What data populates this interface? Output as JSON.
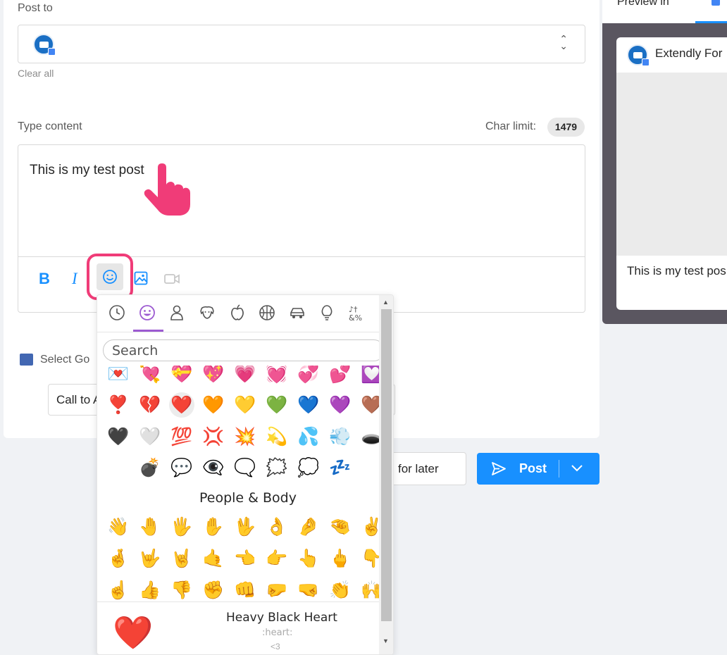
{
  "form": {
    "post_to_label": "Post to",
    "clear_all": "Clear all",
    "type_content_label": "Type content",
    "char_limit_label": "Char limit:",
    "char_limit_value": "1479",
    "content_text": "This is my test post",
    "gmb_label": "Select Go",
    "cta_value": "Call to A",
    "save_later": "for later",
    "post_button": "Post"
  },
  "preview": {
    "title": "Preview in",
    "account_name": "Extendly For",
    "post_text": "This is my test pos"
  },
  "emoji_picker": {
    "categories": [
      "recent-icon",
      "smileys-icon",
      "people-icon",
      "animals-icon",
      "food-icon",
      "activity-icon",
      "travel-icon",
      "objects-icon",
      "symbols-icon"
    ],
    "search_placeholder": "Search",
    "rows": [
      [
        "💌",
        "💘",
        "💝",
        "💖",
        "💗",
        "💓",
        "💞",
        "💕",
        "💟"
      ],
      [
        "❣️",
        "💔",
        "❤️",
        "🧡",
        "💛",
        "💚",
        "💙",
        "💜",
        "🤎"
      ],
      [
        "🖤",
        "🤍",
        "💯",
        "💢",
        "💥",
        "💫",
        "💦",
        "💨",
        "🕳️"
      ],
      [
        "",
        "💣",
        "💬",
        "👁️‍🗨️",
        "🗨️",
        "🗯️",
        "💭",
        "💤",
        ""
      ]
    ],
    "section_title": "People & Body",
    "people_rows": [
      [
        "👋",
        "🤚",
        "🖐️",
        "✋",
        "🖖",
        "👌",
        "🤌",
        "🤏",
        "✌️"
      ],
      [
        "🤞",
        "🤟",
        "🤘",
        "🤙",
        "👈",
        "👉",
        "👆",
        "🖕",
        "👇"
      ],
      [
        "☝️",
        "👍",
        "👎",
        "✊",
        "👊",
        "🤛",
        "🤜",
        "👏",
        "🙌"
      ]
    ],
    "preview_emoji": "❤️",
    "preview_name": "Heavy Black Heart",
    "preview_code": ":heart:",
    "preview_alt": "<3"
  },
  "colors": {
    "accent": "#1890ff",
    "highlight": "#f03c78",
    "picker_accent": "#9c5ad1"
  }
}
